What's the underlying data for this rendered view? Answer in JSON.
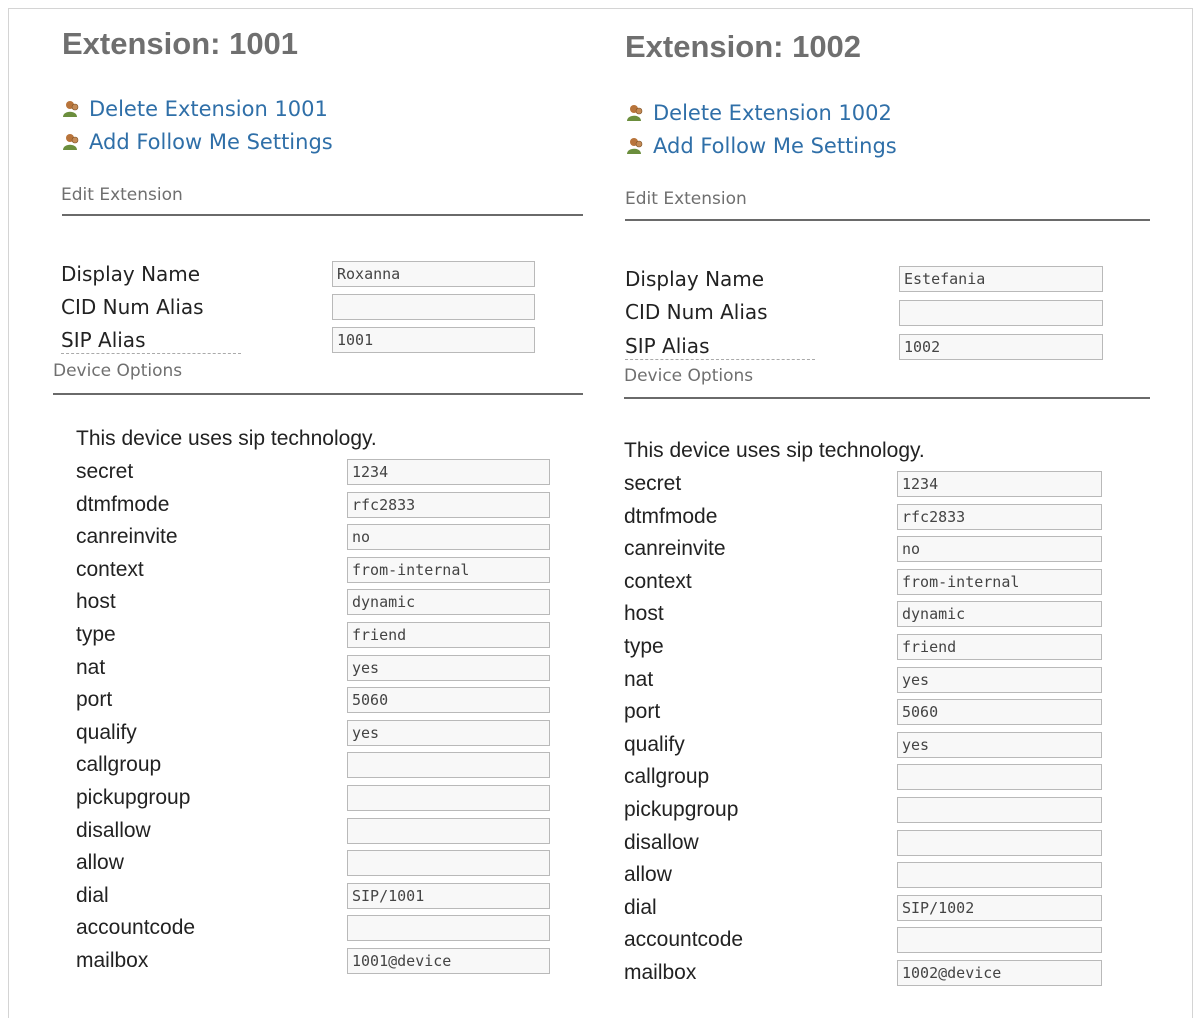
{
  "extensions": [
    {
      "title": "Extension: 1001",
      "actions": [
        {
          "label": "Delete Extension 1001",
          "icon": "user-icon"
        },
        {
          "label": "Add Follow Me Settings",
          "icon": "user-icon"
        }
      ],
      "edit_section_title": "Edit Extension",
      "fields": [
        {
          "label": "Display Name",
          "value": "Roxanna"
        },
        {
          "label": "CID Num Alias",
          "value": ""
        },
        {
          "label": "SIP Alias",
          "value": "1001"
        }
      ],
      "device_section_title": "Device Options",
      "device_note": "This device uses sip technology.",
      "device_fields": [
        {
          "label": "secret",
          "value": "1234"
        },
        {
          "label": "dtmfmode",
          "value": "rfc2833"
        },
        {
          "label": "canreinvite",
          "value": "no"
        },
        {
          "label": "context",
          "value": "from-internal"
        },
        {
          "label": "host",
          "value": "dynamic"
        },
        {
          "label": "type",
          "value": "friend"
        },
        {
          "label": "nat",
          "value": "yes"
        },
        {
          "label": "port",
          "value": "5060"
        },
        {
          "label": "qualify",
          "value": "yes"
        },
        {
          "label": "callgroup",
          "value": ""
        },
        {
          "label": "pickupgroup",
          "value": ""
        },
        {
          "label": "disallow",
          "value": ""
        },
        {
          "label": "allow",
          "value": ""
        },
        {
          "label": "dial",
          "value": "SIP/1001"
        },
        {
          "label": "accountcode",
          "value": ""
        },
        {
          "label": "mailbox",
          "value": "1001@device"
        }
      ]
    },
    {
      "title": "Extension: 1002",
      "actions": [
        {
          "label": "Delete Extension 1002",
          "icon": "user-icon"
        },
        {
          "label": "Add Follow Me Settings",
          "icon": "user-icon"
        }
      ],
      "edit_section_title": "Edit Extension",
      "fields": [
        {
          "label": "Display Name",
          "value": "Estefania"
        },
        {
          "label": "CID Num Alias",
          "value": ""
        },
        {
          "label": "SIP Alias",
          "value": "1002"
        }
      ],
      "device_section_title": "Device Options",
      "device_note": "This device uses sip technology.",
      "device_fields": [
        {
          "label": "secret",
          "value": "1234"
        },
        {
          "label": "dtmfmode",
          "value": "rfc2833"
        },
        {
          "label": "canreinvite",
          "value": "no"
        },
        {
          "label": "context",
          "value": "from-internal"
        },
        {
          "label": "host",
          "value": "dynamic"
        },
        {
          "label": "type",
          "value": "friend"
        },
        {
          "label": "nat",
          "value": "yes"
        },
        {
          "label": "port",
          "value": "5060"
        },
        {
          "label": "qualify",
          "value": "yes"
        },
        {
          "label": "callgroup",
          "value": ""
        },
        {
          "label": "pickupgroup",
          "value": ""
        },
        {
          "label": "disallow",
          "value": ""
        },
        {
          "label": "allow",
          "value": ""
        },
        {
          "label": "dial",
          "value": "SIP/1002"
        },
        {
          "label": "accountcode",
          "value": ""
        },
        {
          "label": "mailbox",
          "value": "1002@device"
        }
      ]
    }
  ],
  "colors": {
    "title": "#6f6f6f",
    "link": "#2f6fa8",
    "rule": "#6a6a6a",
    "input_border": "#b9b9b9",
    "input_bg": "#f8f8f8"
  }
}
